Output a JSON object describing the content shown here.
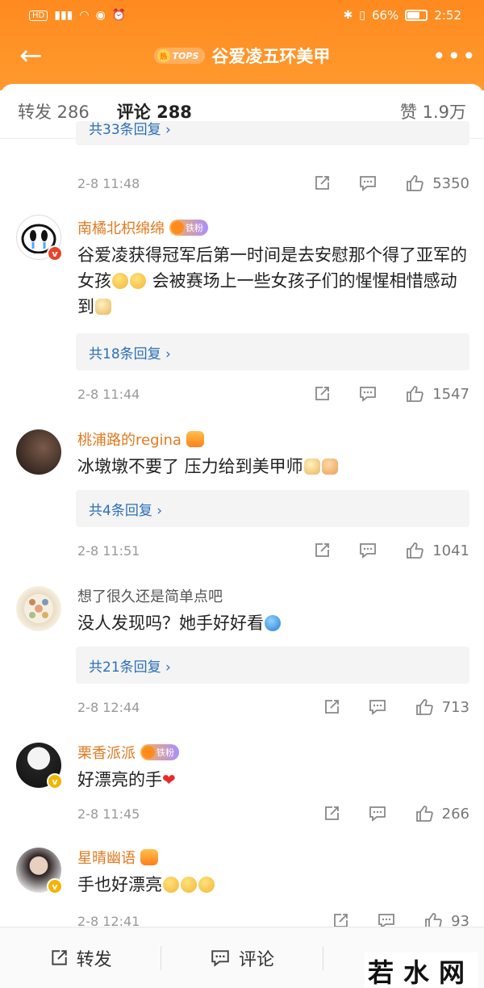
{
  "status_bar": {
    "time": "2:52",
    "battery": "66%",
    "battery_level": 0.66
  },
  "nav": {
    "title": "谷爱凌五环美甲",
    "tops_badge": "TOPS"
  },
  "tabs": {
    "repost": "转发 286",
    "comment": "评论 288",
    "likes": "赞 1.9万"
  },
  "partial_reply": "共33条回复 ›",
  "comments": [
    {
      "time": "2-8 11:48",
      "likes": "5350"
    },
    {
      "user": "南橘北枳绵绵",
      "fan_badge": "铁粉",
      "text_a": "谷爱凌获得冠军后第一时间是去安慰那个得了亚军的女孩",
      "text_b": " 会被赛场上一些女孩子们的惺惺相惜感动到",
      "replies": "共18条回复 ›",
      "time": "2-8 11:44",
      "likes": "1547"
    },
    {
      "user": "桃浦路的regina",
      "text": "冰墩墩不要了 压力给到美甲师",
      "replies": "共4条回复 ›",
      "time": "2-8 11:51",
      "likes": "1041"
    },
    {
      "user": "想了很久还是简单点吧",
      "text": "没人发现吗？她手好好看",
      "replies": "共21条回复 ›",
      "time": "2-8 12:44",
      "likes": "713"
    },
    {
      "user": "栗香派派",
      "fan_badge": "铁粉",
      "text": "好漂亮的手",
      "time": "2-8 11:45",
      "likes": "266"
    },
    {
      "user": "星晴幽语",
      "text": "手也好漂亮",
      "time": "2-8 12:41",
      "likes": "93"
    }
  ],
  "bottom_bar": {
    "repost": "转发",
    "comment": "评论"
  },
  "watermark": "若水网",
  "colors": {
    "accent": "#ff8a1f",
    "username": "#e07a1f",
    "link": "#2a6fb8"
  },
  "icons": [
    "back-arrow-icon",
    "more-dots-icon",
    "share-icon",
    "comment-icon",
    "thumb-up-icon",
    "heart-emoji"
  ]
}
